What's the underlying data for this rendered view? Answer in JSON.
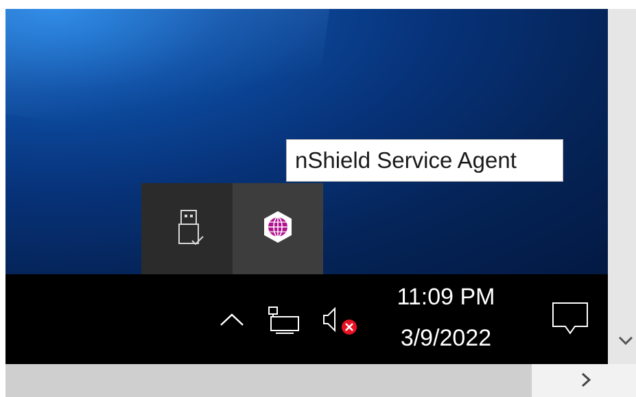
{
  "tooltip": {
    "text": "nShield Service Agent"
  },
  "flyout": {
    "items": [
      {
        "icon": "usb-drive-icon",
        "label": "Safely Remove Hardware"
      },
      {
        "icon": "nshield-globe-icon",
        "label": "nShield Service Agent"
      }
    ]
  },
  "tray": {
    "show_hidden_icons": "chevron-up-icon",
    "network": "network-monitor-icon",
    "volume": "speaker-muted-icon",
    "time": "11:09 PM",
    "date": "3/9/2022",
    "action_center": "notification-icon"
  },
  "colors": {
    "taskbar": "#000000",
    "flyout": "#2b2b2b",
    "flyout_hover": "#3d3d3d",
    "nshield_accent": "#b0138f",
    "error_badge": "#e81123"
  }
}
